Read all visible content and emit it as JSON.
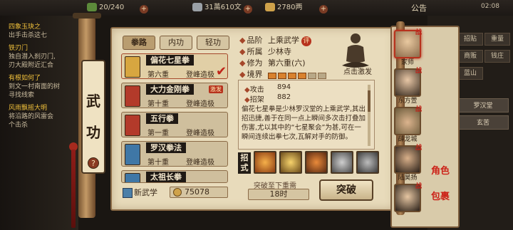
{
  "topbar": {
    "stamina": "20/240",
    "silver": "31萬610文",
    "gold": "2780两",
    "notice_label": "公告",
    "time": "02:08"
  },
  "quest_log": [
    {
      "title": "四象玉玦之",
      "desc": "出手击杀这七"
    },
    {
      "title": "铁刃门",
      "desc": "独自潜入刹刃门,"
    },
    {
      "title": "",
      "desc": "刃大殿附近汇合"
    },
    {
      "title": "有根如何了",
      "desc": "到文一村南面的树"
    },
    {
      "title": "",
      "desc": "寻找线索"
    },
    {
      "title": "风雨飘摇大明",
      "desc": "将沿路的风雷会"
    },
    {
      "title": "",
      "desc": "个击杀"
    }
  ],
  "right_menu": {
    "buttons": [
      "招贴",
      "重量",
      "商贩",
      "钱庄",
      "蓝山"
    ],
    "list": [
      "罗汉堂",
      "玄苦"
    ]
  },
  "scroll_banner": {
    "line1": "武",
    "line2": "功",
    "help": "?"
  },
  "tabs": [
    "拳路",
    "内功",
    "轻功"
  ],
  "skills": [
    {
      "name": "偏花七星拳",
      "level": "第六重",
      "stage": "登峰造极",
      "badge": "",
      "selected": true
    },
    {
      "name": "大力金刚拳",
      "level": "第十重",
      "stage": "登峰造极",
      "badge": "激发",
      "selected": false
    },
    {
      "name": "五行拳",
      "level": "第一重",
      "stage": "登峰造极",
      "badge": "",
      "selected": false
    },
    {
      "name": "罗汉拳法",
      "level": "第十重",
      "stage": "登峰造极",
      "badge": "",
      "selected": false
    },
    {
      "name": "太祖长拳",
      "level": "",
      "stage": "",
      "badge": "",
      "selected": false
    }
  ],
  "bottom_left": {
    "new_label": "新武学",
    "points": "75078"
  },
  "detail": {
    "rank_key": "品阶",
    "rank": "上乘武学",
    "rank_badge": "评",
    "school_key": "所属",
    "school": "少林寺",
    "cultivation_key": "修为",
    "cultivation": "第六重(六)",
    "realm_key": "境界",
    "realm_bars_filled": 4,
    "realm_bars_total": 6,
    "figure_caption": "点击激发",
    "attack_key": "攻击",
    "attack": "894",
    "parry_key": "招架",
    "parry": "882",
    "description": "偏花七星拳是少林罗汉堂的上乘武学,其出招迅捷,善于在同一点上瞬间多次击打叠加伤害,尤以其中的“七星聚会”为甚,可在一瞬间连续出拳七次,瓦解对手的防御。",
    "moves_label": "招式",
    "req_label": "突破至下重需",
    "req_value": "18时",
    "break_label": "突破"
  },
  "characters": [
    {
      "name": "家师",
      "mark": "战",
      "selected": true
    },
    {
      "name": "东方萱",
      "mark": "战",
      "selected": false
    },
    {
      "name": "薛龙城",
      "mark": "战",
      "selected": false
    },
    {
      "name": "陆昊扬",
      "mark": "战",
      "selected": false
    },
    {
      "name": "",
      "mark": "战",
      "selected": false
    }
  ],
  "side_tags": [
    "角色",
    "包裹"
  ],
  "colors": {
    "accent_red": "#b7321d",
    "gold": "#f1c13b",
    "paper": "#e8dbbb"
  }
}
